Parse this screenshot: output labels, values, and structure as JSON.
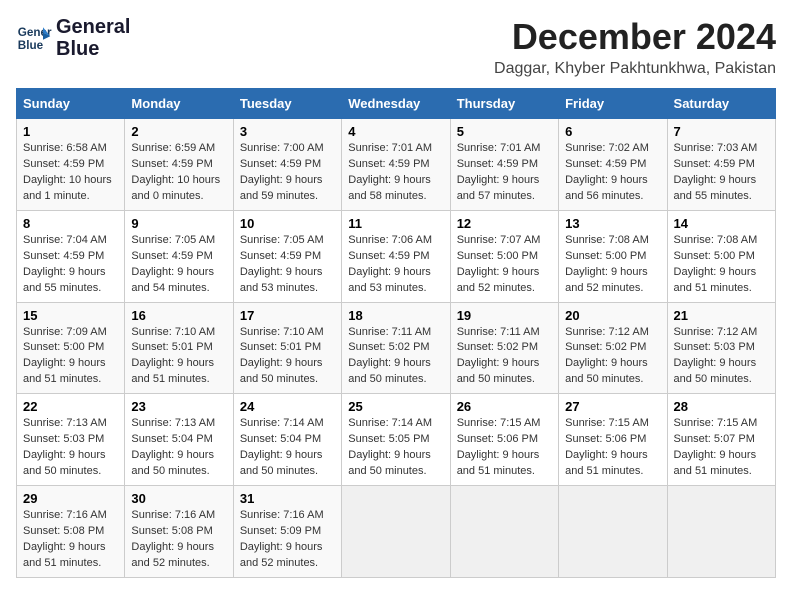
{
  "header": {
    "logo_line1": "General",
    "logo_line2": "Blue",
    "month": "December 2024",
    "location": "Daggar, Khyber Pakhtunkhwa, Pakistan"
  },
  "columns": [
    "Sunday",
    "Monday",
    "Tuesday",
    "Wednesday",
    "Thursday",
    "Friday",
    "Saturday"
  ],
  "weeks": [
    [
      {
        "day": "1",
        "sunrise": "6:58 AM",
        "sunset": "4:59 PM",
        "daylight": "10 hours and 1 minute."
      },
      {
        "day": "2",
        "sunrise": "6:59 AM",
        "sunset": "4:59 PM",
        "daylight": "10 hours and 0 minutes."
      },
      {
        "day": "3",
        "sunrise": "7:00 AM",
        "sunset": "4:59 PM",
        "daylight": "9 hours and 59 minutes."
      },
      {
        "day": "4",
        "sunrise": "7:01 AM",
        "sunset": "4:59 PM",
        "daylight": "9 hours and 58 minutes."
      },
      {
        "day": "5",
        "sunrise": "7:01 AM",
        "sunset": "4:59 PM",
        "daylight": "9 hours and 57 minutes."
      },
      {
        "day": "6",
        "sunrise": "7:02 AM",
        "sunset": "4:59 PM",
        "daylight": "9 hours and 56 minutes."
      },
      {
        "day": "7",
        "sunrise": "7:03 AM",
        "sunset": "4:59 PM",
        "daylight": "9 hours and 55 minutes."
      }
    ],
    [
      {
        "day": "8",
        "sunrise": "7:04 AM",
        "sunset": "4:59 PM",
        "daylight": "9 hours and 55 minutes."
      },
      {
        "day": "9",
        "sunrise": "7:05 AM",
        "sunset": "4:59 PM",
        "daylight": "9 hours and 54 minutes."
      },
      {
        "day": "10",
        "sunrise": "7:05 AM",
        "sunset": "4:59 PM",
        "daylight": "9 hours and 53 minutes."
      },
      {
        "day": "11",
        "sunrise": "7:06 AM",
        "sunset": "4:59 PM",
        "daylight": "9 hours and 53 minutes."
      },
      {
        "day": "12",
        "sunrise": "7:07 AM",
        "sunset": "5:00 PM",
        "daylight": "9 hours and 52 minutes."
      },
      {
        "day": "13",
        "sunrise": "7:08 AM",
        "sunset": "5:00 PM",
        "daylight": "9 hours and 52 minutes."
      },
      {
        "day": "14",
        "sunrise": "7:08 AM",
        "sunset": "5:00 PM",
        "daylight": "9 hours and 51 minutes."
      }
    ],
    [
      {
        "day": "15",
        "sunrise": "7:09 AM",
        "sunset": "5:00 PM",
        "daylight": "9 hours and 51 minutes."
      },
      {
        "day": "16",
        "sunrise": "7:10 AM",
        "sunset": "5:01 PM",
        "daylight": "9 hours and 51 minutes."
      },
      {
        "day": "17",
        "sunrise": "7:10 AM",
        "sunset": "5:01 PM",
        "daylight": "9 hours and 50 minutes."
      },
      {
        "day": "18",
        "sunrise": "7:11 AM",
        "sunset": "5:02 PM",
        "daylight": "9 hours and 50 minutes."
      },
      {
        "day": "19",
        "sunrise": "7:11 AM",
        "sunset": "5:02 PM",
        "daylight": "9 hours and 50 minutes."
      },
      {
        "day": "20",
        "sunrise": "7:12 AM",
        "sunset": "5:02 PM",
        "daylight": "9 hours and 50 minutes."
      },
      {
        "day": "21",
        "sunrise": "7:12 AM",
        "sunset": "5:03 PM",
        "daylight": "9 hours and 50 minutes."
      }
    ],
    [
      {
        "day": "22",
        "sunrise": "7:13 AM",
        "sunset": "5:03 PM",
        "daylight": "9 hours and 50 minutes."
      },
      {
        "day": "23",
        "sunrise": "7:13 AM",
        "sunset": "5:04 PM",
        "daylight": "9 hours and 50 minutes."
      },
      {
        "day": "24",
        "sunrise": "7:14 AM",
        "sunset": "5:04 PM",
        "daylight": "9 hours and 50 minutes."
      },
      {
        "day": "25",
        "sunrise": "7:14 AM",
        "sunset": "5:05 PM",
        "daylight": "9 hours and 50 minutes."
      },
      {
        "day": "26",
        "sunrise": "7:15 AM",
        "sunset": "5:06 PM",
        "daylight": "9 hours and 51 minutes."
      },
      {
        "day": "27",
        "sunrise": "7:15 AM",
        "sunset": "5:06 PM",
        "daylight": "9 hours and 51 minutes."
      },
      {
        "day": "28",
        "sunrise": "7:15 AM",
        "sunset": "5:07 PM",
        "daylight": "9 hours and 51 minutes."
      }
    ],
    [
      {
        "day": "29",
        "sunrise": "7:16 AM",
        "sunset": "5:08 PM",
        "daylight": "9 hours and 51 minutes."
      },
      {
        "day": "30",
        "sunrise": "7:16 AM",
        "sunset": "5:08 PM",
        "daylight": "9 hours and 52 minutes."
      },
      {
        "day": "31",
        "sunrise": "7:16 AM",
        "sunset": "5:09 PM",
        "daylight": "9 hours and 52 minutes."
      },
      null,
      null,
      null,
      null
    ]
  ]
}
